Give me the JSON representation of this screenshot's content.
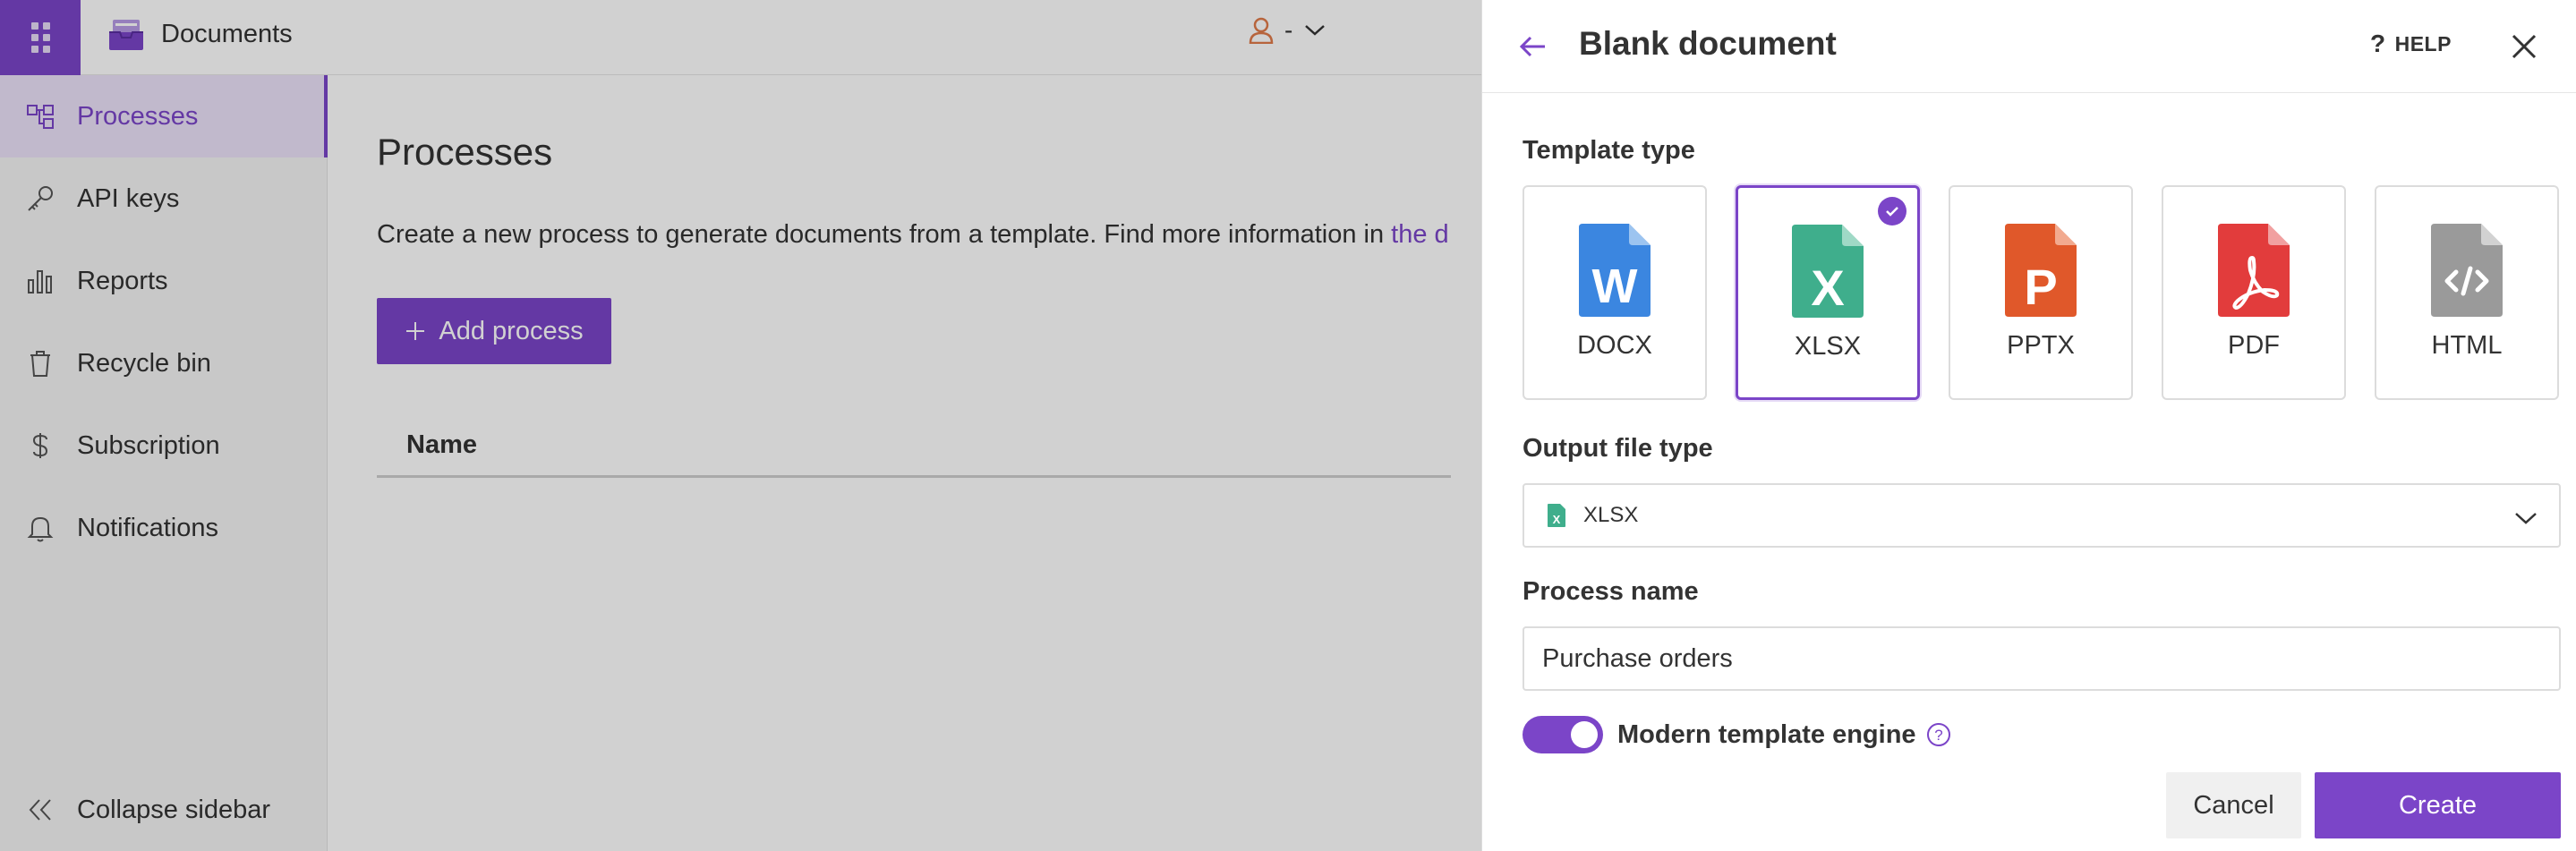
{
  "app": {
    "name": "Documents",
    "user_label": "-"
  },
  "sidebar": {
    "items": [
      {
        "label": "Processes",
        "active": true
      },
      {
        "label": "API keys"
      },
      {
        "label": "Reports"
      },
      {
        "label": "Recycle bin"
      },
      {
        "label": "Subscription"
      },
      {
        "label": "Notifications"
      }
    ],
    "collapse_label": "Collapse sidebar"
  },
  "main": {
    "title": "Processes",
    "description": "Create a new process to generate documents from a template. Find more information in ",
    "description_link": "the d",
    "add_button": "Add process",
    "table_header_name": "Name"
  },
  "panel": {
    "title": "Blank document",
    "help_label": "HELP",
    "template_type_label": "Template type",
    "templates": [
      {
        "label": "DOCX",
        "letter": "W",
        "color": "#3b86e0"
      },
      {
        "label": "XLSX",
        "letter": "X",
        "color": "#3fae8c",
        "selected": true
      },
      {
        "label": "PPTX",
        "letter": "P",
        "color": "#e0582a"
      },
      {
        "label": "PDF",
        "letter": "pdf",
        "color": "#e23c3c"
      },
      {
        "label": "HTML",
        "letter": "code",
        "color": "#9a9a9a"
      }
    ],
    "output_file_type_label": "Output file type",
    "output_file_type_value": "XLSX",
    "process_name_label": "Process name",
    "process_name_value": "Purchase orders",
    "engine_label": "Modern template engine",
    "engine_enabled": true,
    "cancel_label": "Cancel",
    "create_label": "Create"
  },
  "colors": {
    "accent": "#7b45c8",
    "xlsx": "#3fae8c"
  }
}
